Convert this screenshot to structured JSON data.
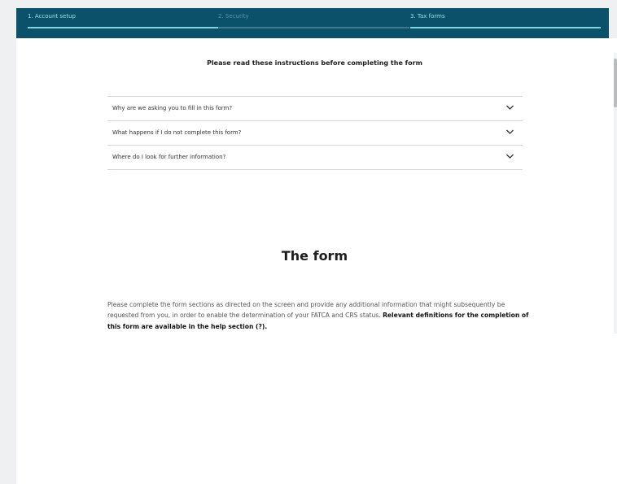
{
  "stepper": {
    "steps": [
      {
        "label": "1. Account setup",
        "state": "completed"
      },
      {
        "label": "2. Security",
        "state": "inactive"
      },
      {
        "label": "3. Tax forms",
        "state": "current"
      }
    ]
  },
  "instructions": {
    "title": "Please read these instructions before completing the form",
    "items": [
      {
        "label": "Why are we asking you to fill in this form?"
      },
      {
        "label": "What happens if I do not complete this form?"
      },
      {
        "label": "Where do I look for further information?"
      }
    ]
  },
  "form": {
    "title": "The form",
    "description": "Please complete the form sections as directed on the screen and provide any additional information that might subsequently be requested from you, in order to enable the determination of your FATCA and CRS status.",
    "description_bold": "Relevant definitions for the completion of this form are available in the help section (?)."
  },
  "colors": {
    "header_bg": "#0a5169",
    "active_accent": "#7fd5de",
    "panel_bg": "#ffffff",
    "page_bg": "#eef0f2"
  },
  "icons": {
    "accordion_toggle": "chevron-down-icon"
  }
}
